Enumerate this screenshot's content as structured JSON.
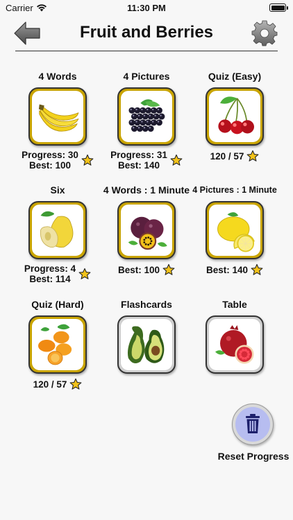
{
  "status_bar": {
    "carrier": "Carrier",
    "time": "11:30 PM"
  },
  "header": {
    "title": "Fruit and Berries",
    "back_icon": "back-arrow-icon",
    "settings_icon": "gear-icon"
  },
  "tiles": [
    {
      "label": "4 Words",
      "image": "banana",
      "line1": "Progress: 30",
      "line2": "Best: 100",
      "star": true
    },
    {
      "label": "4 Pictures",
      "image": "blackberry",
      "line1": "Progress: 31",
      "line2": "Best: 140",
      "star": true
    },
    {
      "label": "Quiz (Easy)",
      "image": "cherry",
      "line1": "120 / 57",
      "line2": "",
      "star": true
    },
    {
      "label": "Six",
      "image": "quince",
      "line1": "Progress: 4",
      "line2": "Best: 114",
      "star": true
    },
    {
      "label": "4 Words : 1 Minute",
      "image": "passion-fruit",
      "line1": "Best: 100",
      "line2": "",
      "star": true
    },
    {
      "label": "4 Pictures : 1 Minute",
      "image": "lemon",
      "line1": "Best: 140",
      "line2": "",
      "star": true
    },
    {
      "label": "Quiz (Hard)",
      "image": "kumquat",
      "line1": "120 / 57",
      "line2": "",
      "star": true
    },
    {
      "label": "Flashcards",
      "image": "avocado",
      "line1": "",
      "line2": "",
      "star": false
    },
    {
      "label": "Table",
      "image": "pomegranate",
      "line1": "",
      "line2": "",
      "star": false
    }
  ],
  "reset": {
    "label": "Reset Progress",
    "icon": "trash-icon"
  },
  "colors": {
    "gold_frame": "#c9a400",
    "star_fill": "#f2c21a",
    "reset_bg": "#b7bdf0"
  }
}
